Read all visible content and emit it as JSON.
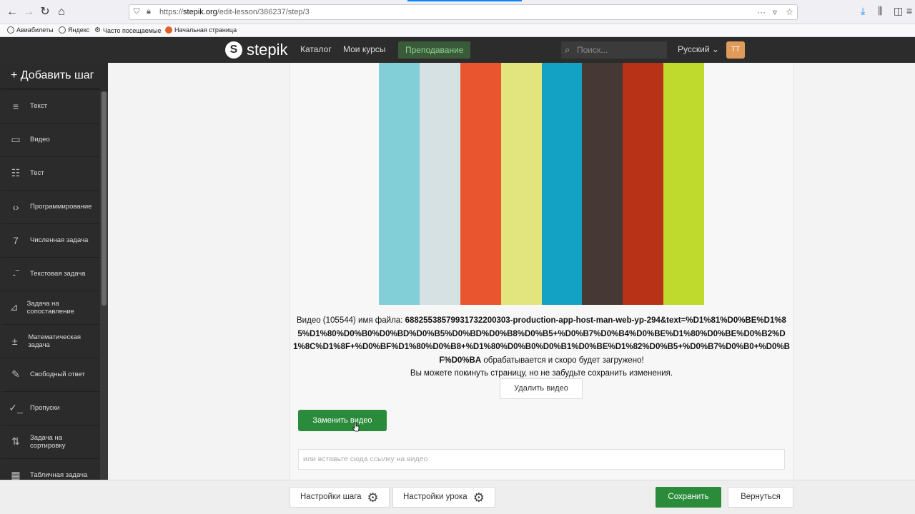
{
  "browser": {
    "url_prefix": "https://",
    "url_host": "stepik.org",
    "url_path": "/edit-lesson/386237/step/3",
    "bookmarks": [
      "Авиабилеты",
      "Яндекс",
      "Часто посещаемые",
      "Начальная страница"
    ]
  },
  "header": {
    "logo_text": "stepik",
    "nav": [
      "Каталог",
      "Мои курсы"
    ],
    "active_nav": "Преподавание",
    "search_placeholder": "Поиск...",
    "language": "Русский ⌄",
    "avatar_initials": "TT"
  },
  "sidebar": {
    "add_step": "+ Добавить шаг",
    "items": [
      {
        "label": "Текст",
        "icon": "text-lines-icon"
      },
      {
        "label": "Видео",
        "icon": "video-icon"
      },
      {
        "label": "Тест",
        "icon": "test-icon"
      },
      {
        "label": "Программирование",
        "icon": "code-icon"
      },
      {
        "label": "Численная задача",
        "icon": "number-icon"
      },
      {
        "label": "Текстовая задача",
        "icon": "text-task-icon"
      },
      {
        "label": "Задача на сопоставление",
        "icon": "matching-icon"
      },
      {
        "label": "Математическая задача",
        "icon": "math-icon"
      },
      {
        "label": "Свободный ответ",
        "icon": "pencil-icon"
      },
      {
        "label": "Пропуски",
        "icon": "fill-blanks-icon"
      },
      {
        "label": "Задача на сортировку",
        "icon": "sorting-icon"
      },
      {
        "label": "Табличная задача",
        "icon": "table-icon"
      }
    ]
  },
  "main": {
    "video_colors": [
      "#82cfd8",
      "#d5e1e3",
      "#e8552e",
      "#e2e47e",
      "#14a2c4",
      "#463834",
      "#b73217",
      "#c0d92d"
    ],
    "status_prefix": "Видео (105544) имя файла: ",
    "status_filename": "6882553857993173220030​3-production-app-host-man-web-yp-294&text=%D1%81%D0%BE%D1%85%D1%80%D0%B0%D0%BD%D0%B5%D0%BD%D0%B8%D0%B5+%D0%B7%D0%B4%D0%BE%D1%80%D0%BE%D0%B2%D1%8C%D1%8F+%D0%BF%D1%80%D0%B8+%D1%80%D0%B0%D0%B1%D0%BE%D1%82%D0%B5+%D0%B7%D0%B0+%D0%BF%D0%BA",
    "status_suffix": " обрабатывается и скоро будет загружено!",
    "status_note": "Вы можете покинуть страницу, но не забудьте сохранить изменения.",
    "delete_video": "Удалить видео",
    "replace_video": "Заменить видео",
    "url_placeholder": "или вставьте сюда ссылку на видео"
  },
  "bottom": {
    "step_settings": "Настройки шага",
    "lesson_settings": "Настройки урока",
    "save": "Сохранить",
    "back": "Вернуться"
  }
}
